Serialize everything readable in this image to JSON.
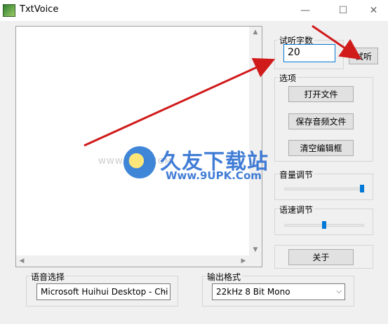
{
  "window": {
    "title": "TxtVoice",
    "min_glyph": "—",
    "max_glyph": "☐",
    "close_glyph": "✕"
  },
  "editor": {
    "text": ""
  },
  "scroll_glyphs": {
    "up": "▲",
    "down": "▼",
    "left": "◀",
    "right": "▶"
  },
  "listen_count": {
    "label": "试听字数",
    "value": "20",
    "button_label": "试听"
  },
  "options": {
    "label": "选项",
    "open_label": "打开文件",
    "save_label": "保存音频文件",
    "clear_label": "清空编辑框"
  },
  "volume": {
    "label": "音量调节",
    "level": 1.0
  },
  "speed": {
    "label": "语速调节",
    "level": 0.5
  },
  "about": {
    "label": "关于"
  },
  "voice": {
    "label": "语音选择",
    "selected": "Microsoft Huihui Desktop - Chi"
  },
  "format": {
    "label": "输出格式",
    "selected": "22kHz 8 Bit Mono"
  },
  "select_chevron": "⌵",
  "watermark": {
    "name": "久友下载站",
    "url": "Www.9UPK.Com",
    "faint": "WWW.9UPK.COM"
  },
  "colors": {
    "accent": "#0078d7",
    "annotation_arrow": "#d11a1a",
    "watermark": "#2d6fd2"
  }
}
